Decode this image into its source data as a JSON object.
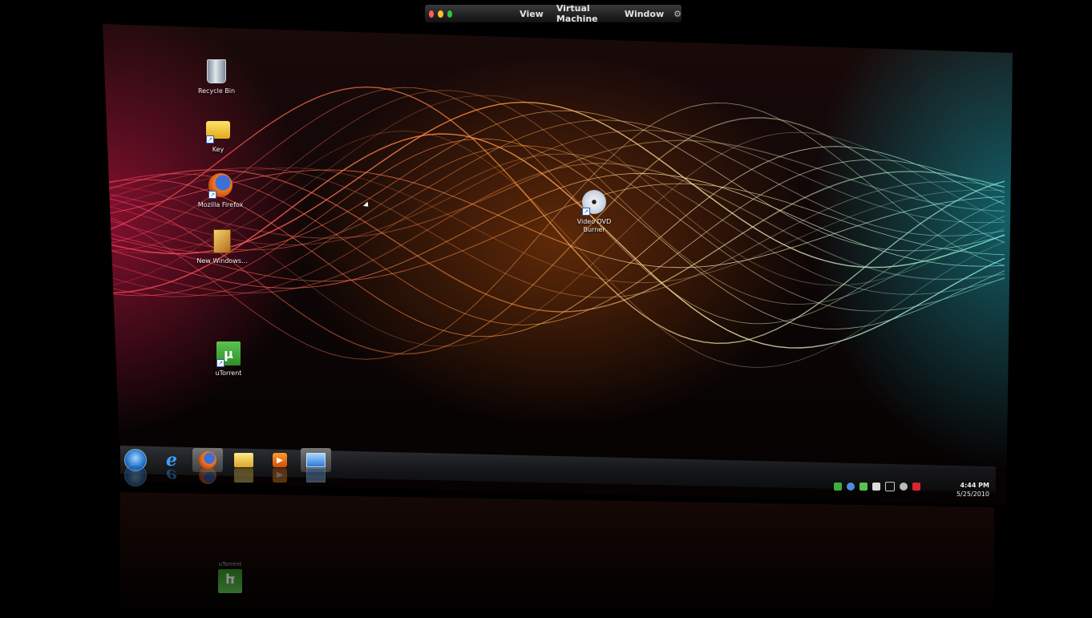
{
  "menubar": {
    "items": [
      "View",
      "Virtual Machine",
      "Window"
    ],
    "gear_icon": "gear-icon",
    "traffic_colors": [
      "#ff5f57",
      "#ffbd2e",
      "#28c940"
    ]
  },
  "desktop": {
    "icons": [
      {
        "label": "Recycle Bin",
        "icon": "recycle-bin-icon"
      },
      {
        "label": "Key",
        "icon": "folder-icon"
      },
      {
        "label": "Mozilla Firefox",
        "icon": "firefox-icon"
      },
      {
        "label": "New Windows...",
        "icon": "document-icon"
      },
      {
        "label": "Video DVD Burner",
        "icon": "disc-icon"
      },
      {
        "label": "uTorrent",
        "icon": "utorrent-icon"
      }
    ]
  },
  "taskbar": {
    "buttons": [
      {
        "name": "start",
        "icon": "windows-orb-icon"
      },
      {
        "name": "internet-explorer",
        "icon": "ie-icon"
      },
      {
        "name": "firefox",
        "icon": "firefox-icon"
      },
      {
        "name": "explorer",
        "icon": "folder-icon"
      },
      {
        "name": "media-player",
        "icon": "media-player-icon"
      },
      {
        "name": "remote-desktop",
        "icon": "monitor-icon"
      }
    ],
    "active_index": 2
  },
  "tray": {
    "icons": [
      "network-icon",
      "bluetooth-icon",
      "utorrent-tray-icon",
      "security-icon",
      "sync-icon",
      "volume-icon",
      "flag-icon"
    ],
    "time": "4:44 PM",
    "date": "5/25/2010"
  },
  "reflection": {
    "label": "uTorrent"
  },
  "colors": {
    "wave_warm": "#ff9a3c",
    "wave_red": "#ff3c64",
    "wave_cyan": "#7fe8d8",
    "accent_green": "#3fae3a"
  }
}
